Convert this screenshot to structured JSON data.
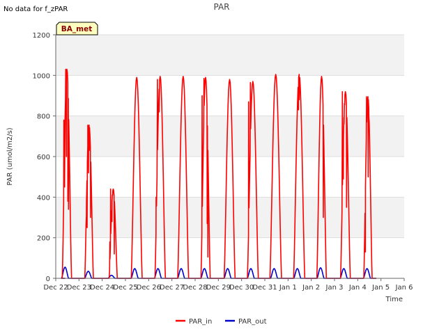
{
  "no_data_note": "No data for f_zPAR",
  "badge": {
    "text": "BA_met",
    "fill": "#ffffc0",
    "text_color": "#8b0000"
  },
  "chart_data": {
    "type": "line",
    "title": "PAR",
    "xlabel": "Time",
    "ylabel": "PAR (umol/m2/s)",
    "ylim": [
      0,
      1200
    ],
    "xlim": [
      0,
      15
    ],
    "yticks": [
      0,
      200,
      400,
      600,
      800,
      1000,
      1200
    ],
    "xtick_labels": [
      "Dec 22",
      "Dec 23",
      "Dec 24",
      "Dec 25",
      "Dec 26",
      "Dec 27",
      "Dec 28",
      "Dec 29",
      "Dec 30",
      "Dec 31",
      "Jan 1",
      "Jan 2",
      "Jan 3",
      "Jan 4",
      "Jan 5",
      "Jan 6"
    ],
    "grid": true,
    "band_colors": [
      "#f2f2f2",
      "#ffffff"
    ],
    "legend_position": "bottom-center",
    "series": [
      {
        "name": "PAR_in",
        "color": "#ff0000",
        "days": [
          {
            "day": 0.4,
            "start": 0.28,
            "end": 0.68,
            "peak": 1030,
            "spikes": [
              [
                0.35,
                780
              ],
              [
                0.38,
                450
              ],
              [
                0.43,
                1030
              ],
              [
                0.46,
                600
              ],
              [
                0.52,
                380
              ],
              [
                0.55,
                340
              ]
            ]
          },
          {
            "day": 1.4,
            "start": 0.25,
            "end": 0.62,
            "peak": 755,
            "spikes": [
              [
                0.32,
                310
              ],
              [
                0.35,
                250
              ],
              [
                0.38,
                755
              ],
              [
                0.41,
                520
              ],
              [
                0.44,
                630
              ],
              [
                0.5,
                300
              ]
            ]
          },
          {
            "day": 2.4,
            "start": 0.3,
            "end": 0.65,
            "peak": 440,
            "spikes": [
              [
                0.33,
                180
              ],
              [
                0.36,
                440
              ],
              [
                0.42,
                280
              ],
              [
                0.45,
                410
              ],
              [
                0.52,
                120
              ]
            ]
          },
          {
            "day": 3.4,
            "start": 0.25,
            "end": 0.72,
            "peak": 990,
            "spikes": []
          },
          {
            "day": 4.4,
            "start": 0.27,
            "end": 0.72,
            "peak": 995,
            "spikes": [
              [
                0.32,
                400
              ],
              [
                0.38,
                980
              ],
              [
                0.45,
                820
              ]
            ]
          },
          {
            "day": 5.4,
            "start": 0.25,
            "end": 0.72,
            "peak": 995,
            "spikes": []
          },
          {
            "day": 6.4,
            "start": 0.25,
            "end": 0.65,
            "peak": 990,
            "spikes": [
              [
                0.3,
                900
              ],
              [
                0.38,
                985
              ],
              [
                0.52,
                270
              ],
              [
                0.55,
                105
              ]
            ]
          },
          {
            "day": 7.4,
            "start": 0.25,
            "end": 0.72,
            "peak": 980,
            "spikes": []
          },
          {
            "day": 8.4,
            "start": 0.25,
            "end": 0.72,
            "peak": 970,
            "spikes": [
              [
                0.3,
                870
              ],
              [
                0.38,
                965
              ]
            ]
          },
          {
            "day": 9.4,
            "start": 0.22,
            "end": 0.72,
            "peak": 1005,
            "spikes": []
          },
          {
            "day": 10.4,
            "start": 0.24,
            "end": 0.72,
            "peak": 1005,
            "spikes": [
              [
                0.45,
                830
              ],
              [
                0.48,
                880
              ]
            ]
          },
          {
            "day": 11.4,
            "start": 0.24,
            "end": 0.65,
            "peak": 995,
            "spikes": [
              [
                0.52,
                300
              ],
              [
                0.55,
                610
              ]
            ]
          },
          {
            "day": 12.4,
            "start": 0.26,
            "end": 0.68,
            "peak": 920,
            "spikes": [
              [
                0.34,
                920
              ],
              [
                0.38,
                490
              ],
              [
                0.41,
                760
              ],
              [
                0.44,
                855
              ],
              [
                0.52,
                350
              ]
            ]
          },
          {
            "day": 13.4,
            "start": 0.26,
            "end": 0.62,
            "peak": 895,
            "spikes": [
              [
                0.33,
                130
              ],
              [
                0.38,
                895
              ],
              [
                0.45,
                500
              ],
              [
                0.48,
                795
              ]
            ]
          }
        ]
      },
      {
        "name": "PAR_out",
        "color": "#0000cc",
        "days": [
          {
            "day": 0.4,
            "peak": 55
          },
          {
            "day": 1.4,
            "peak": 35
          },
          {
            "day": 2.4,
            "peak": 15
          },
          {
            "day": 3.4,
            "peak": 48
          },
          {
            "day": 4.4,
            "peak": 48
          },
          {
            "day": 5.4,
            "peak": 48
          },
          {
            "day": 6.4,
            "peak": 48
          },
          {
            "day": 7.4,
            "peak": 48
          },
          {
            "day": 8.4,
            "peak": 48
          },
          {
            "day": 9.4,
            "peak": 48
          },
          {
            "day": 10.4,
            "peak": 48
          },
          {
            "day": 11.4,
            "peak": 52
          },
          {
            "day": 12.4,
            "peak": 48
          },
          {
            "day": 13.4,
            "peak": 48
          }
        ]
      }
    ]
  }
}
